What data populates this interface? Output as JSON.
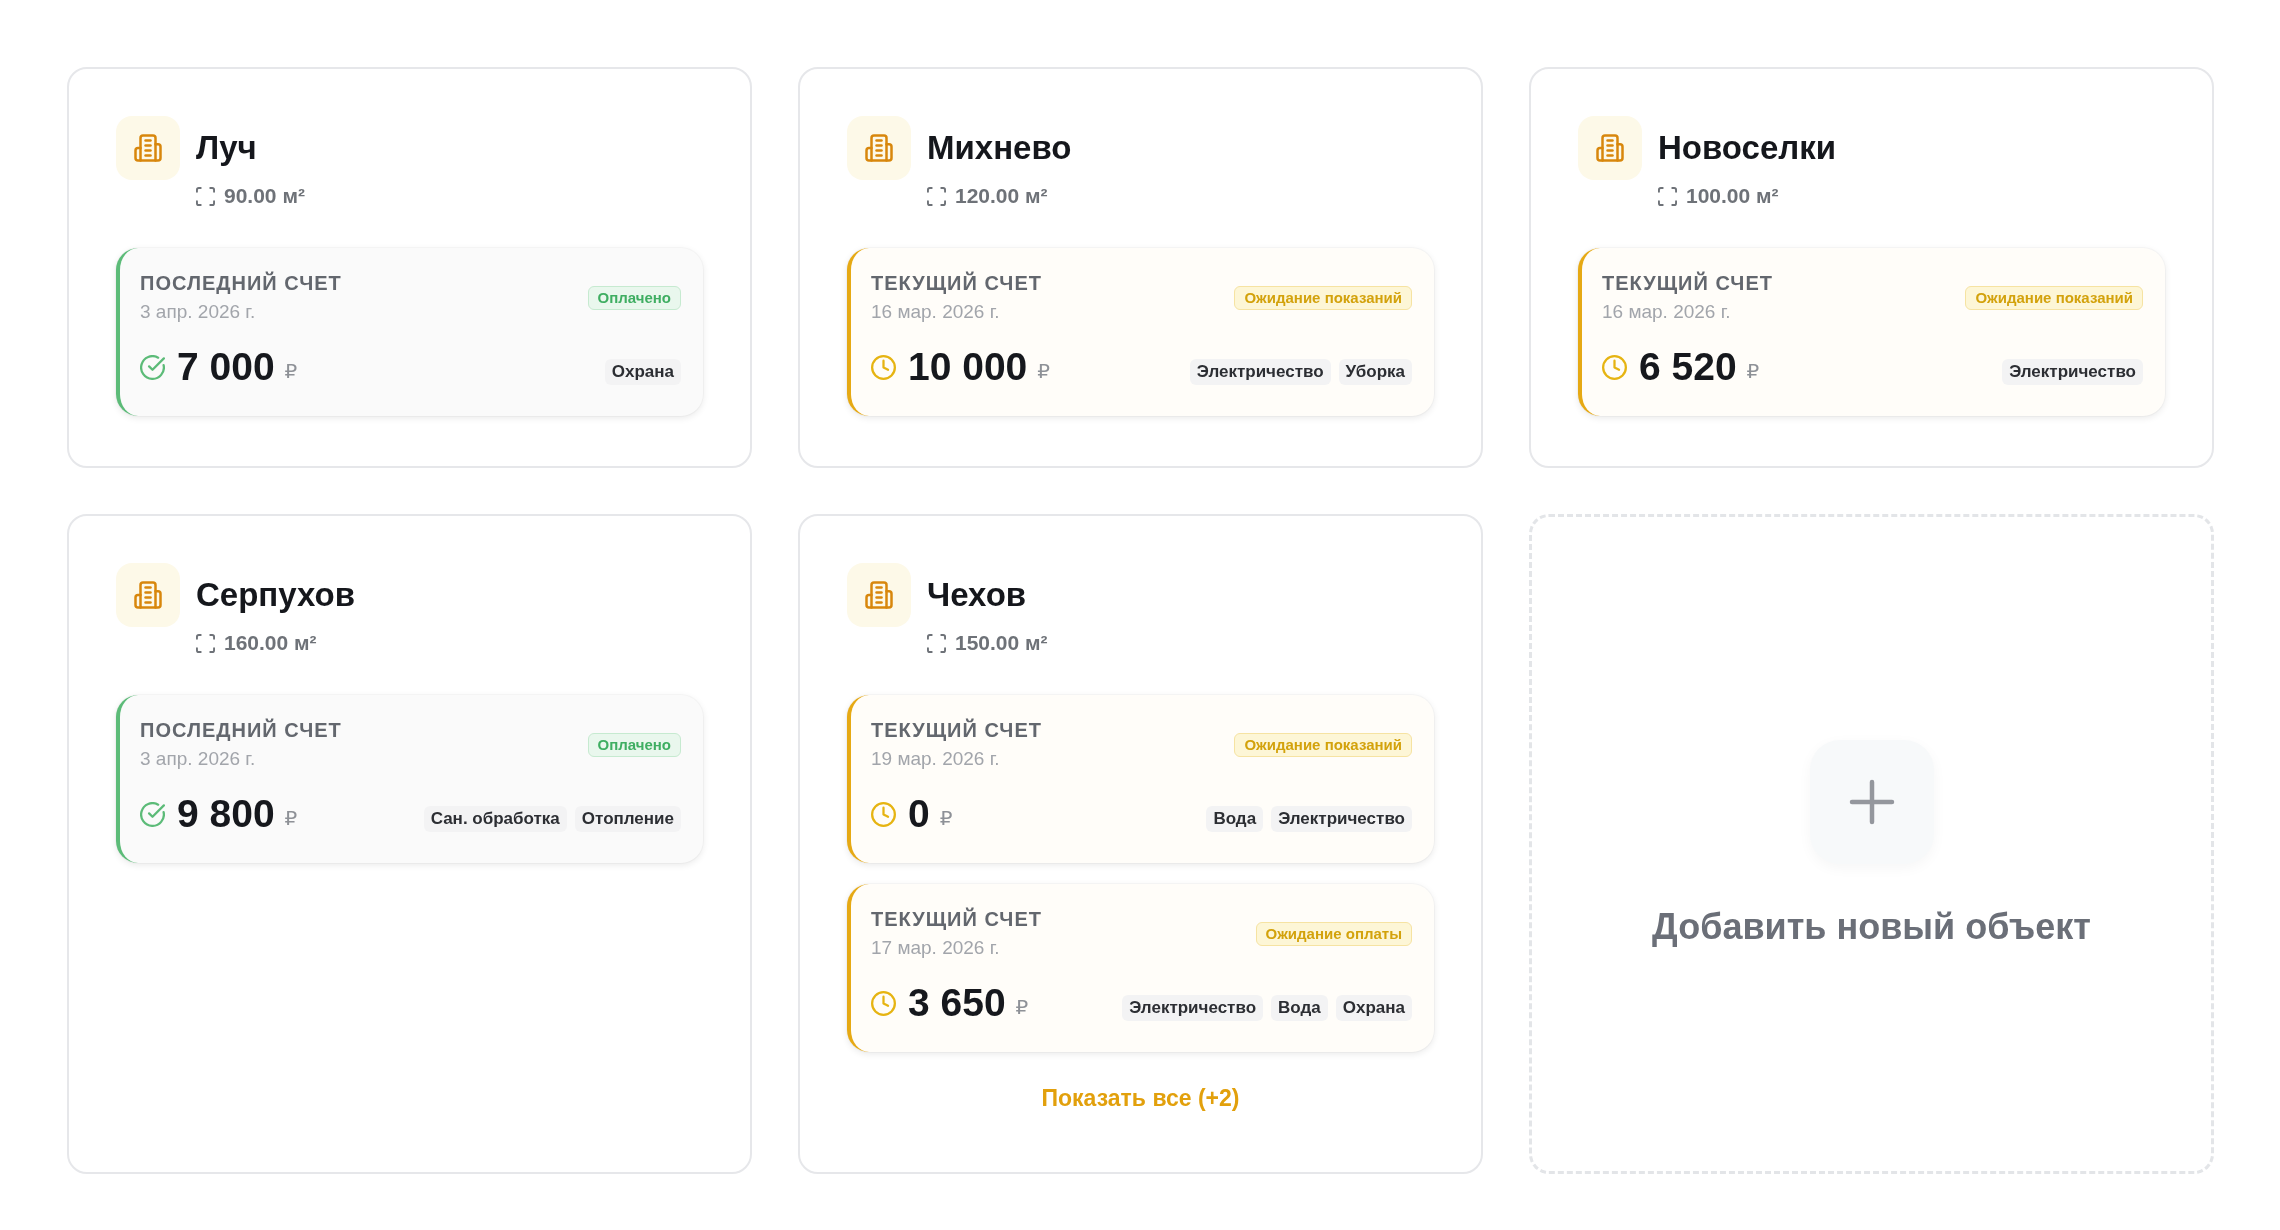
{
  "properties": [
    {
      "name": "Луч",
      "area": "90.00 м²",
      "bills": [
        {
          "label": "ПОСЛЕДНИЙ СЧЕТ",
          "date": "3 апр. 2026 г.",
          "kind": "paid",
          "status_label": "Оплачено",
          "amount": "7 000",
          "currency": "₽",
          "services": [
            "Охрана"
          ]
        }
      ]
    },
    {
      "name": "Михнево",
      "area": "120.00 м²",
      "bills": [
        {
          "label": "ТЕКУЩИЙ СЧЕТ",
          "date": "16 мар. 2026 г.",
          "kind": "pending",
          "status_label": "Ожидание показаний",
          "amount": "10 000",
          "currency": "₽",
          "services": [
            "Электричество",
            "Уборка"
          ]
        }
      ]
    },
    {
      "name": "Новоселки",
      "area": "100.00 м²",
      "bills": [
        {
          "label": "ТЕКУЩИЙ СЧЕТ",
          "date": "16 мар. 2026 г.",
          "kind": "pending",
          "status_label": "Ожидание показаний",
          "amount": "6 520",
          "currency": "₽",
          "services": [
            "Электричество"
          ]
        }
      ]
    },
    {
      "name": "Серпухов",
      "area": "160.00 м²",
      "bills": [
        {
          "label": "ПОСЛЕДНИЙ СЧЕТ",
          "date": "3 апр. 2026 г.",
          "kind": "paid",
          "status_label": "Оплачено",
          "amount": "9 800",
          "currency": "₽",
          "services": [
            "Сан. обработка",
            "Отопление"
          ]
        }
      ]
    },
    {
      "name": "Чехов",
      "area": "150.00 м²",
      "bills": [
        {
          "label": "ТЕКУЩИЙ СЧЕТ",
          "date": "19 мар. 2026 г.",
          "kind": "pending",
          "status_label": "Ожидание показаний",
          "amount": "0",
          "currency": "₽",
          "services": [
            "Вода",
            "Электричество"
          ]
        },
        {
          "label": "ТЕКУЩИЙ СЧЕТ",
          "date": "17 мар. 2026 г.",
          "kind": "pending",
          "status_label": "Ожидание оплаты",
          "amount": "3 650",
          "currency": "₽",
          "services": [
            "Электричество",
            "Вода",
            "Охрана"
          ]
        }
      ],
      "show_all": "Показать все (+2)"
    }
  ],
  "add_card": {
    "label": "Добавить новый объект"
  }
}
